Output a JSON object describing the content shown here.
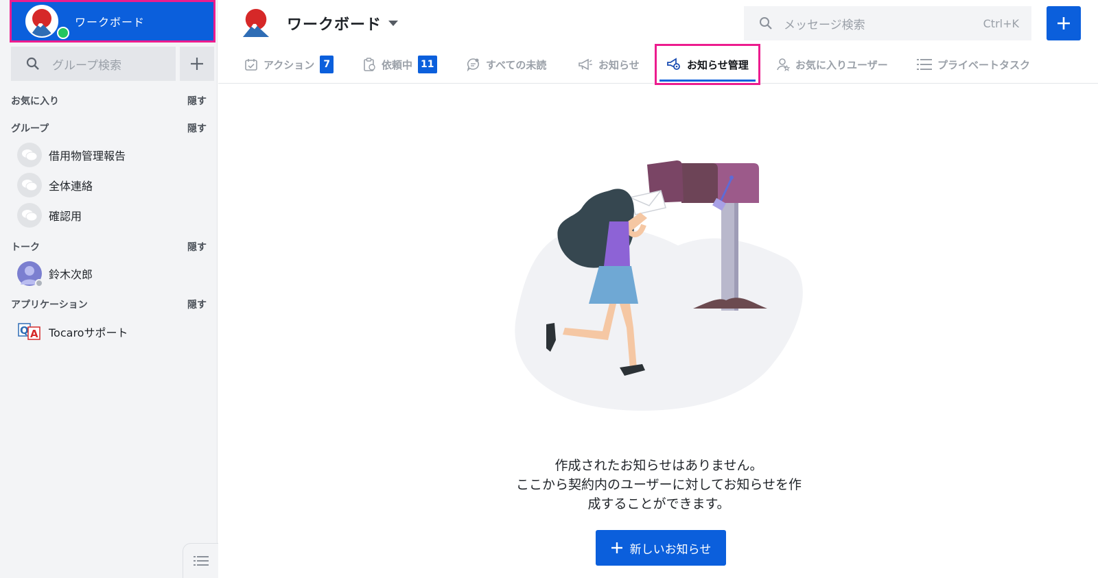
{
  "workspace": {
    "name": "ワークボード"
  },
  "sidebar": {
    "group_search_placeholder": "グループ検索",
    "sections": {
      "favorites": {
        "title": "お気に入り",
        "hide": "隠す"
      },
      "groups": {
        "title": "グループ",
        "hide": "隠す",
        "items": [
          "借用物管理報告",
          "全体連絡",
          "確認用"
        ]
      },
      "talk": {
        "title": "トーク",
        "hide": "隠す",
        "items": [
          "鈴木次郎"
        ]
      },
      "apps": {
        "title": "アプリケーション",
        "hide": "隠す",
        "items": [
          "Tocaroサポート"
        ]
      }
    }
  },
  "header": {
    "title": "ワークボード",
    "search_placeholder": "メッセージ検索",
    "search_shortcut": "Ctrl+K"
  },
  "tabs": [
    {
      "label": "アクション",
      "badge": "7",
      "icon": "calendar-check-icon"
    },
    {
      "label": "依頼中",
      "badge": "11",
      "icon": "clipboard-icon"
    },
    {
      "label": "すべての未読",
      "icon": "chat-bubble-icon"
    },
    {
      "label": "お知らせ",
      "icon": "megaphone-icon"
    },
    {
      "label": "お知らせ管理",
      "icon": "megaphone-gear-icon",
      "active": true
    },
    {
      "label": "お気に入りユーザー",
      "icon": "user-star-icon"
    },
    {
      "label": "プライベートタスク",
      "icon": "list-icon"
    }
  ],
  "main": {
    "empty_lines": [
      "作成されたお知らせはありません。",
      "ここから契約内のユーザーに対してお知らせを作",
      "成することができます。"
    ],
    "new_button_label": "新しいお知らせ"
  },
  "colors": {
    "accent": "#0b5fdc",
    "highlight": "#ec1c8e"
  }
}
